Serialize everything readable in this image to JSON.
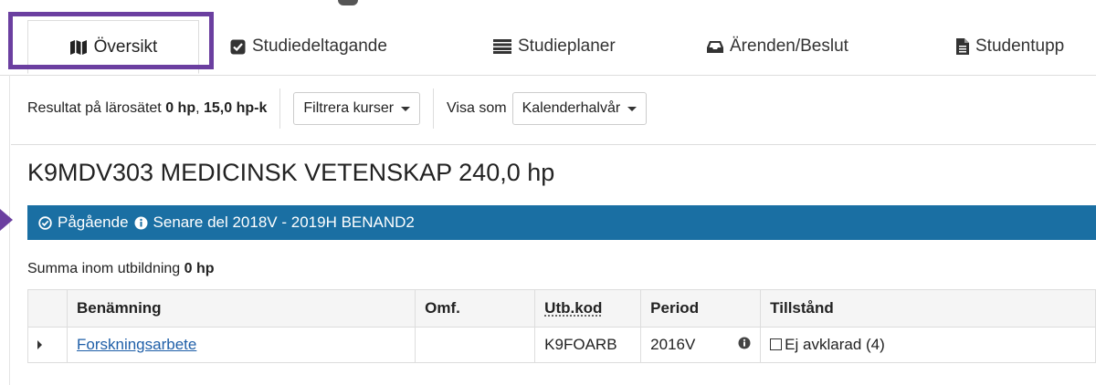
{
  "tabs": [
    {
      "label": "Översikt",
      "icon": "map-icon",
      "active": true
    },
    {
      "label": "Studiedeltagande",
      "icon": "check-square-icon"
    },
    {
      "label": "Studieplaner",
      "icon": "list-icon"
    },
    {
      "label": "Ärenden/Beslut",
      "icon": "inbox-icon"
    },
    {
      "label": "Studentupp",
      "icon": "file-icon"
    }
  ],
  "filter": {
    "result_prefix": "Resultat på lärosätet",
    "result_hp": "0 hp",
    "result_sep": ",",
    "result_hpk": "15,0 hp-k",
    "filter_button": "Filtrera kurser",
    "visa_label": "Visa som",
    "visa_button": "Kalenderhalvår"
  },
  "program": {
    "title": "K9MDV303 MEDICINSK VETENSKAP 240,0 hp",
    "status": "Pågående",
    "status_detail": "Senare del 2018V - 2019H BENAND2",
    "summa_prefix": "Summa inom utbildning",
    "summa_value": "0 hp"
  },
  "table": {
    "headers": {
      "name": "Benämning",
      "omf": "Omf.",
      "utb": "Utb.kod",
      "period": "Period",
      "tillstand": "Tillstånd"
    },
    "rows": [
      {
        "name": "Forskningsarbete",
        "omf": "",
        "utb": "K9FOARB",
        "period": "2016V",
        "tillstand": "Ej avklarad (4)"
      }
    ]
  },
  "colors": {
    "status_bar": "#1a6fa3",
    "highlight": "#6b3fa0",
    "link": "#1f5fa8"
  }
}
